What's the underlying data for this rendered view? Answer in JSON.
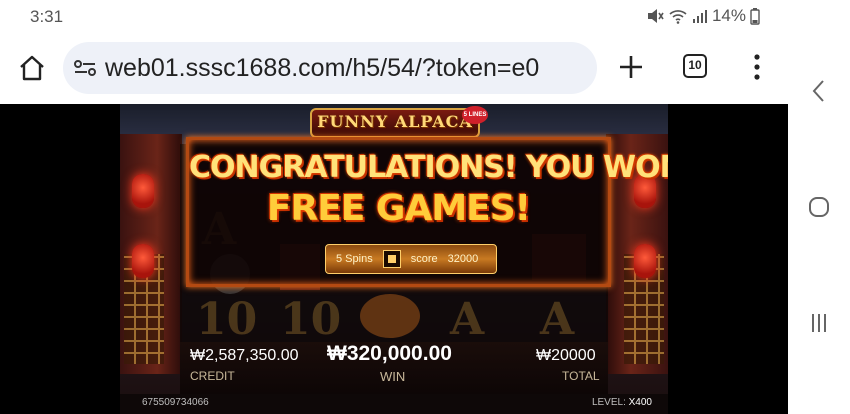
{
  "status_bar": {
    "time": "3:31",
    "battery_percent": "14%",
    "icons": [
      "mute-icon",
      "wifi-icon",
      "signal-icon",
      "battery-icon"
    ]
  },
  "browser": {
    "url": "web01.sssc1688.com/h5/54/?token=e0",
    "tab_count": "10",
    "icons": [
      "home-icon",
      "site-settings-icon",
      "new-tab-plus-icon",
      "tab-switcher-icon",
      "overflow-menu-icon"
    ]
  },
  "nav_bar": {
    "icons": [
      "back-chevron-icon",
      "home-circle-icon",
      "recents-icon"
    ]
  },
  "game": {
    "logo_text": "FUNNY ALPACA",
    "logo_badge": "5 LINES",
    "popup_line1": "CONGRATULATIONS! YOU WON",
    "popup_line2": "FREE GAMES!",
    "spins_text": "5 Spins",
    "score_label": "score",
    "score_value": "32000",
    "credit_value": "₩2,587,350.00",
    "credit_label": "CREDIT",
    "win_value": "₩320,000.00",
    "win_label": "WIN",
    "total_value": "₩20000",
    "total_label": "TOTAL",
    "game_id": "675509734066",
    "level_label": "LEVEL:",
    "level_value": "X400",
    "reel_symbols": [
      "A",
      "10",
      "10",
      "A",
      "A"
    ]
  },
  "colors": {
    "popup_border": "#b44a12",
    "title_gold": "#ffe27a",
    "plate_gold": "#c87a22"
  }
}
